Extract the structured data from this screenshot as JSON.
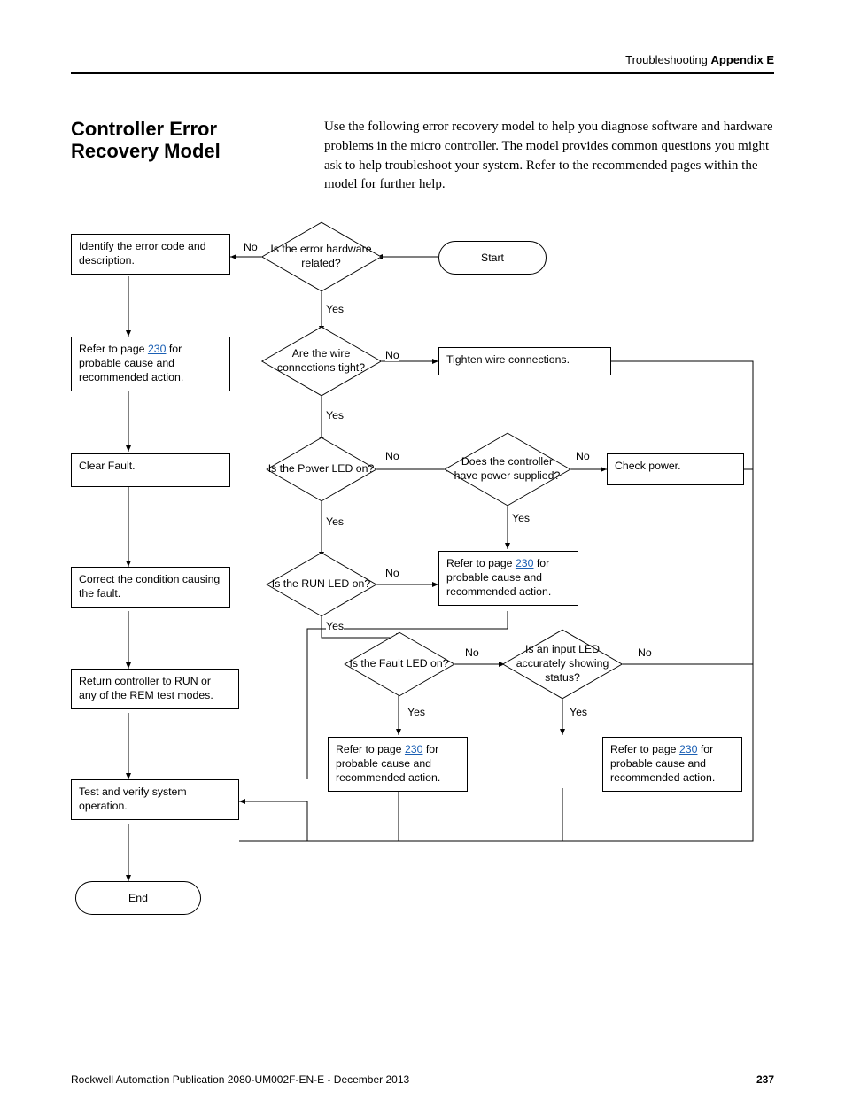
{
  "header": {
    "prefix": "Troubleshooting",
    "suffix": "Appendix E"
  },
  "title": "Controller Error Recovery Model",
  "intro": "Use the following error recovery model to help you diagnose software and hardware problems in the micro controller. The model provides common questions you might ask to help troubleshoot your system. Refer to the recommended pages within the model for further help.",
  "flow": {
    "start": "Start",
    "end": "End",
    "d_hw": "Is the error hardware related?",
    "d_wire": "Are the wire connections tight?",
    "d_power": "Is the Power LED on?",
    "d_run": "Is the RUN LED on?",
    "d_fault": "Is the Fault LED on?",
    "d_supply": "Does the controller have power supplied?",
    "d_inputled": "Is an input LED accurately showing status?",
    "b_identify": "Identify the error code and description.",
    "b_refer1_a": "Refer to page ",
    "b_refer1_b": " for probable cause and recommended action.",
    "b_clear": "Clear Fault.",
    "b_correct": "Correct the condition causing the fault.",
    "b_return": "Return controller to RUN or any of the REM test modes.",
    "b_test": "Test and verify system operation.",
    "b_tighten": "Tighten wire connections.",
    "b_checkpower": "Check power.",
    "link_page": "230",
    "yes": "Yes",
    "no": "No"
  },
  "footer": {
    "pub": "Rockwell Automation Publication 2080-UM002F-EN-E - December 2013",
    "page": "237"
  }
}
